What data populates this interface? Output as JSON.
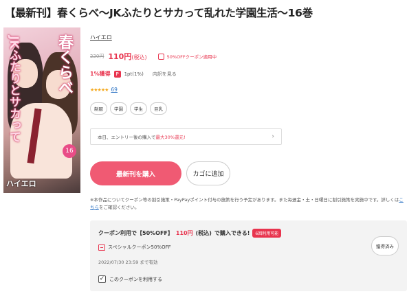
{
  "title": "【最新刊】春くらべ〜JKふたりとサカって乱れた学園生活〜16巻",
  "cover": {
    "vertical_title_1": "春くらべ",
    "vertical_title_2": "JKふたりとサカって",
    "volume_badge": "16",
    "author_mark": "ハイエロ"
  },
  "author": "ハイエロ",
  "price": {
    "old": "220円",
    "new": "110円",
    "tax_note": "(税込)",
    "coupon_label": "50%OFFクーポン適用中"
  },
  "points": {
    "percent": "1%獲得",
    "amount": "1pt(1%)",
    "detail_link": "内訳を見る"
  },
  "rating": {
    "stars": "★★★★★",
    "count": "69"
  },
  "tags": [
    "制服",
    "学園",
    "学生",
    "巨乳"
  ],
  "promo": {
    "text_prefix": "本日、エントリー後の購入で",
    "text_highlight": "最大30%還元!",
    "chevron": "›"
  },
  "buttons": {
    "buy": "最新刊を購入",
    "cart": "カゴに追加"
  },
  "note": {
    "text": "※本作品についてクーポン等の割引施策・PayPayポイント付与の施策を行う予定があります。また毎週金・土・日曜日に割引施策を実施中です。詳しくは",
    "link": "こちら",
    "suffix": "をご確認ください。"
  },
  "coupon_box": {
    "head_prefix": "クーポン利用で【50%OFF】",
    "head_price": "110円",
    "head_tax": "(税込)",
    "head_suffix": "で購入できる!",
    "pill": "6回利用可能",
    "coupon_name": "スペシャルクーポン50%OFF",
    "date": "2022/07/30 23:59 まで有効",
    "use_label": "このクーポンを利用する",
    "obtain_button": "獲得済み"
  },
  "colors": {
    "accent": "#e8344e",
    "buy_button": "#f05a73",
    "star": "#f4a81c",
    "link": "#3478c6"
  }
}
